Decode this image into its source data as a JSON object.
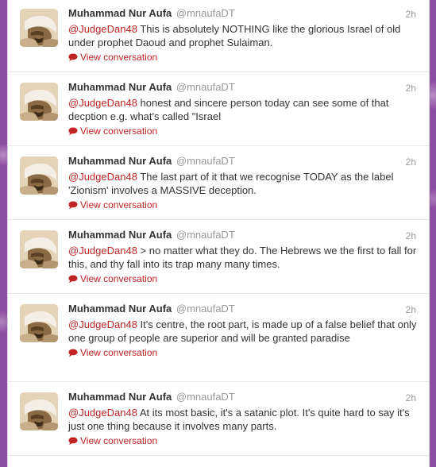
{
  "colors": {
    "page_background": "#8e4fa3",
    "link_accent": "#c02424",
    "name_text": "#333333",
    "muted_text": "#999999"
  },
  "tweets": [
    {
      "fullname": "Muhammad Nur Aufa",
      "username": "@mnaufaDT",
      "time": "2h",
      "mention": "@JudgeDan48",
      "text": " This is absolutely NOTHING like the glorious Israel of old under prophet Daoud and prophet Sulaiman.",
      "action_label": "View conversation",
      "action_icon": "speech-bubble-icon"
    },
    {
      "fullname": "Muhammad Nur Aufa",
      "username": "@mnaufaDT",
      "time": "2h",
      "mention": "@JudgeDan48",
      "text": " honest and sincere person today can see some of that decption e.g. what's called \"Israel",
      "action_label": "View conversation",
      "action_icon": "speech-bubble-icon"
    },
    {
      "fullname": "Muhammad Nur Aufa",
      "username": "@mnaufaDT",
      "time": "2h",
      "mention": "@JudgeDan48",
      "text": " The last part of it that we recognise TODAY as the label 'Zionism' involves a MASSIVE deception.",
      "action_label": "View conversation",
      "action_icon": "speech-bubble-icon"
    },
    {
      "fullname": "Muhammad Nur Aufa",
      "username": "@mnaufaDT",
      "time": "2h",
      "mention": "@JudgeDan48",
      "text": " > no matter what they do. The Hebrews we the first to fall for this, and thy fall into its trap many many times.",
      "action_label": "View conversation",
      "action_icon": "speech-bubble-icon"
    },
    {
      "fullname": "Muhammad Nur Aufa",
      "username": "@mnaufaDT",
      "time": "2h",
      "mention": "@JudgeDan48",
      "text": " It's centre, the root part, is made up of a false belief that only one group of people are superior and will be granted paradise",
      "action_label": "View conversation",
      "action_icon": "speech-bubble-icon"
    },
    {
      "fullname": "Muhammad Nur Aufa",
      "username": "@mnaufaDT",
      "time": "2h",
      "mention": "@JudgeDan48",
      "text": " At its most basic, it's a satanic plot. It's quite hard to say it's just one thing because it involves many parts.",
      "action_label": "View conversation",
      "action_icon": "speech-bubble-icon"
    }
  ]
}
